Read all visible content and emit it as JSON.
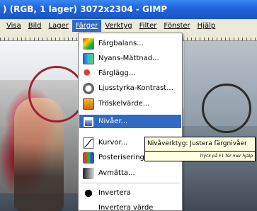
{
  "window": {
    "title": ") (RGB, 1 lager) 3072x2304 - GIMP"
  },
  "menubar": {
    "items": [
      {
        "label": "Visa"
      },
      {
        "label": "Bild"
      },
      {
        "label": "Lager"
      },
      {
        "label": "Färger"
      },
      {
        "label": "Verktyg"
      },
      {
        "label": "Filter"
      },
      {
        "label": "Fönster"
      },
      {
        "label": "Hjälp"
      }
    ],
    "active": "Färger"
  },
  "colors_menu": {
    "items": [
      {
        "label": "Färgbalans...",
        "icon": "color-balance-icon"
      },
      {
        "label": "Nyans-Mättnad...",
        "icon": "hue-saturation-icon"
      },
      {
        "label": "Färglägg...",
        "icon": "colorize-icon"
      },
      {
        "label": "Ljusstyrka-Kontrast...",
        "icon": "brightness-contrast-icon"
      },
      {
        "label": "Tröskelvärde...",
        "icon": "threshold-icon"
      },
      {
        "label": "Nivåer...",
        "icon": "levels-icon",
        "highlighted": true
      },
      {
        "label": "Kurvor...",
        "icon": "curves-icon"
      },
      {
        "label": "Posterisering...",
        "icon": "posterize-icon"
      },
      {
        "label": "Avmätta...",
        "icon": "desaturate-icon"
      },
      {
        "label": "Invertera",
        "icon": "invert-icon"
      },
      {
        "label": "Invertera värde",
        "icon": "invert-value-icon"
      }
    ]
  },
  "tooltip": {
    "text": "Nivåverktyg: Justera färgnivåer",
    "help": "Tryck på F1 för mer hjälp"
  },
  "colors": {
    "titlebar": "#2064d8",
    "highlight": "#316ac5",
    "menubar_bg": "#ece9d8",
    "tooltip_bg": "#ffffe1"
  }
}
